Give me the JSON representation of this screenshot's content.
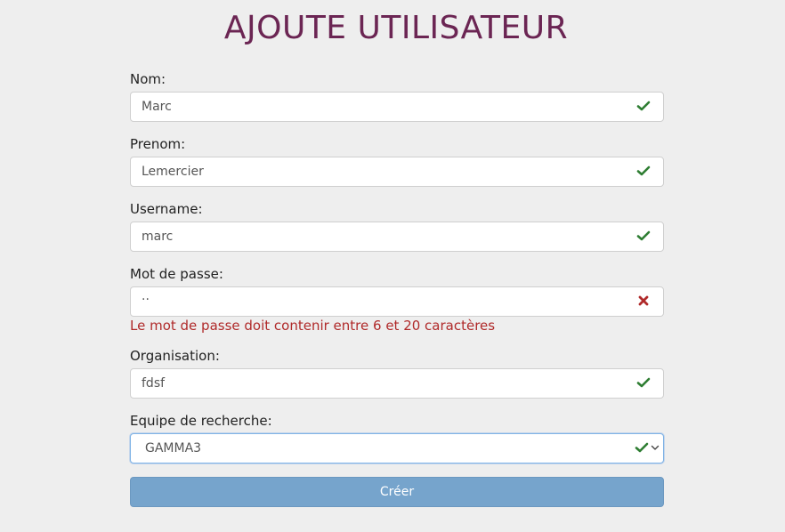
{
  "page": {
    "title": "AJOUTE UTILISATEUR"
  },
  "form": {
    "nom": {
      "label": "Nom:",
      "value": "Marc",
      "status": "valid"
    },
    "prenom": {
      "label": "Prenom:",
      "value": "Lemercier",
      "status": "valid"
    },
    "username": {
      "label": "Username:",
      "value": "marc",
      "status": "valid"
    },
    "password": {
      "label": "Mot de passe:",
      "value": "··",
      "status": "invalid",
      "error": "Le mot de passe doit contenir entre 6 et 20 caractères"
    },
    "organisation": {
      "label": "Organisation:",
      "value": "fdsf",
      "status": "valid"
    },
    "equipe": {
      "label": "Equipe de recherche:",
      "value": "GAMMA3",
      "status": "valid"
    },
    "submit_label": "Créer"
  },
  "colors": {
    "title": "#6b2553",
    "valid": "#2e7d32",
    "invalid": "#b02a2a",
    "submit_bg": "#76a4cc"
  },
  "icons": {
    "valid": "check-icon",
    "invalid": "x-icon",
    "dropdown": "chevron-down-icon"
  }
}
